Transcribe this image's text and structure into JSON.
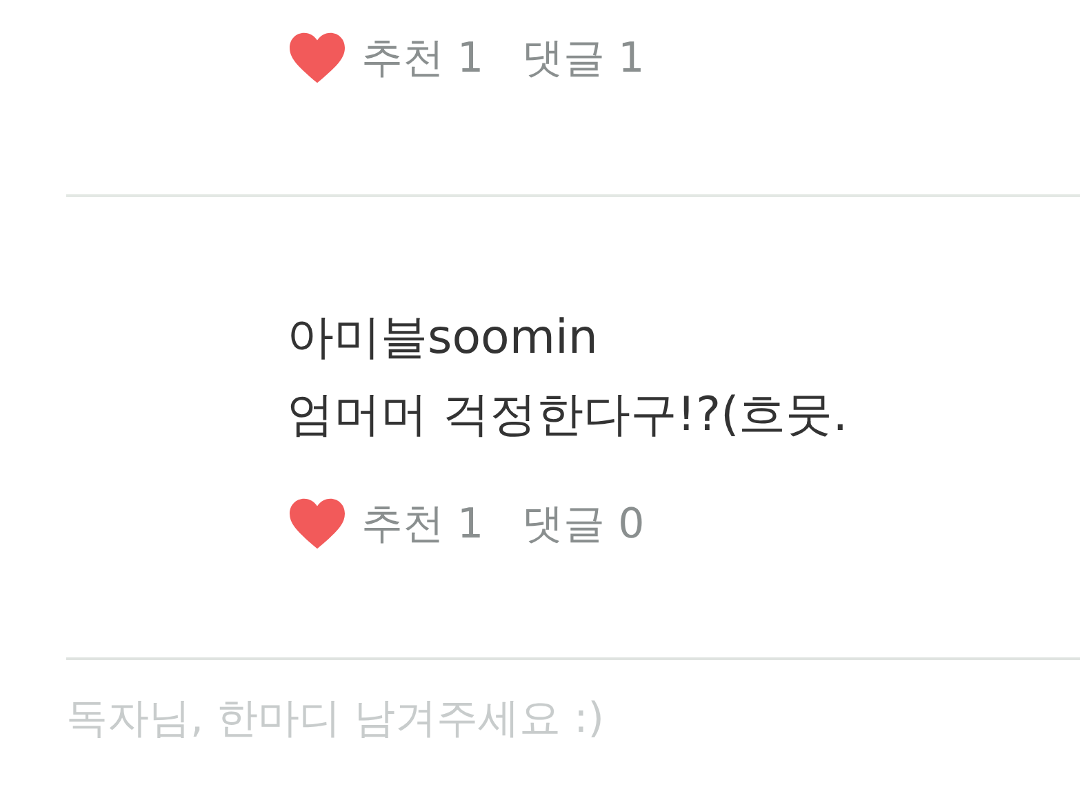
{
  "comments": [
    {
      "likes": "추천 1",
      "replies": "댓글 1",
      "liked": true
    },
    {
      "author": "아미블soomin",
      "text": "엄머머 걱정한다구!?(흐뭇.",
      "likes": "추천 1",
      "replies": "댓글 0",
      "liked": true
    }
  ],
  "reply_field": {
    "placeholder": "독자님, 한마디 남겨주세요 :)"
  }
}
